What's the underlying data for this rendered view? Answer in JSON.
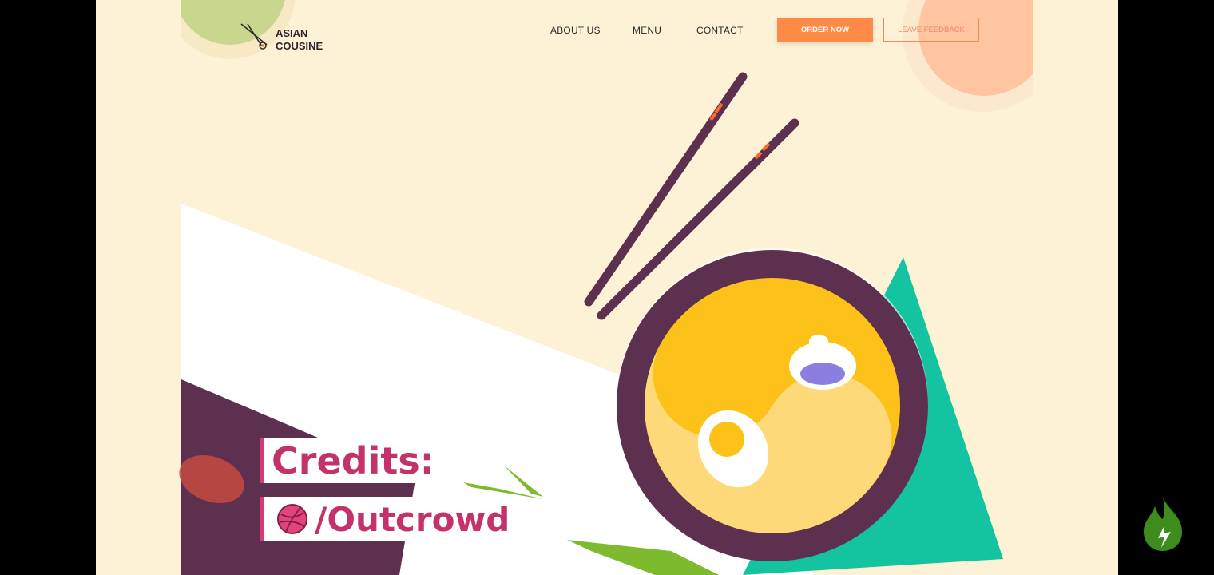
{
  "brand": {
    "line1": "ASIAN",
    "line2": "COUSINE"
  },
  "nav": {
    "about": "ABOUT US",
    "menu": "MENU",
    "contact": "CONTACT"
  },
  "buttons": {
    "order": "ORDER NOW",
    "feedback": "LEAVE FEEDBACK"
  },
  "credits": {
    "title": "Credits:",
    "handle": "/Outcrowd"
  },
  "colors": {
    "background": "#fdf1d6",
    "accent_orange": "#ff8a45",
    "bowl_purple": "#5e3050",
    "soup_yellow": "#fdc21a",
    "teal": "#14c3a0",
    "credit_pink": "#c4326b"
  },
  "icons": [
    "chopsticks-logo-icon",
    "dribbble-icon",
    "fire-icon"
  ]
}
